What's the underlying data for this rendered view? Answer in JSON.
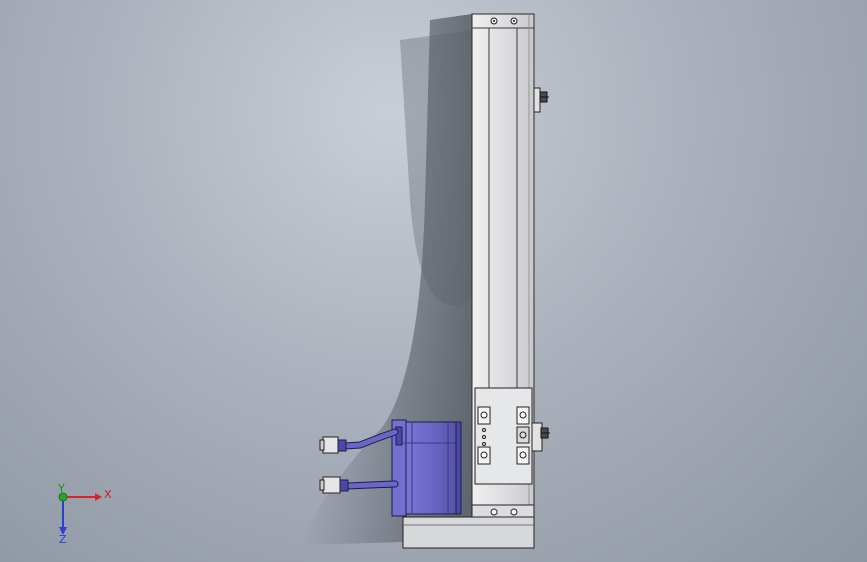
{
  "viewport": {
    "background_top": "#c9ced6",
    "background_bottom": "#8d95a2"
  },
  "model": {
    "frame_color": "#d9dadc",
    "edge_color": "#2a2a2a",
    "motor_color": "#6b67c9",
    "motor_dark": "#4c48a8",
    "cable_color": "#5a57b8"
  },
  "triad": {
    "x_label": "X",
    "y_label": "Y",
    "z_label": "Z",
    "x_color": "#d6262b",
    "y_color": "#2aa52a",
    "z_color": "#2b3fd0"
  }
}
